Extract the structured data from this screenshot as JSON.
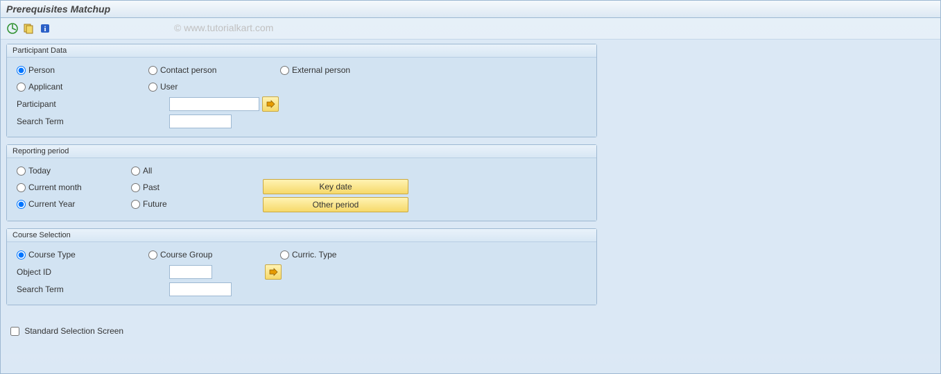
{
  "title": "Prerequisites Matchup",
  "watermark": "© www.tutorialkart.com",
  "participant_data": {
    "title": "Participant Data",
    "radios": {
      "person": "Person",
      "contact_person": "Contact person",
      "external_person": "External person",
      "applicant": "Applicant",
      "user": "User"
    },
    "participant_label": "Participant",
    "participant_value": "",
    "search_term_label": "Search Term",
    "search_term_value": ""
  },
  "reporting_period": {
    "title": "Reporting period",
    "radios": {
      "today": "Today",
      "all": "All",
      "current_month": "Current month",
      "past": "Past",
      "current_year": "Current Year",
      "future": "Future"
    },
    "key_date_btn": "Key date",
    "other_period_btn": "Other period"
  },
  "course_selection": {
    "title": "Course Selection",
    "radios": {
      "course_type": "Course Type",
      "course_group": "Course Group",
      "curric_type": "Curric. Type"
    },
    "object_id_label": "Object ID",
    "object_id_value": "",
    "search_term_label": "Search Term",
    "search_term_value": ""
  },
  "standard_selection": "Standard Selection Screen"
}
